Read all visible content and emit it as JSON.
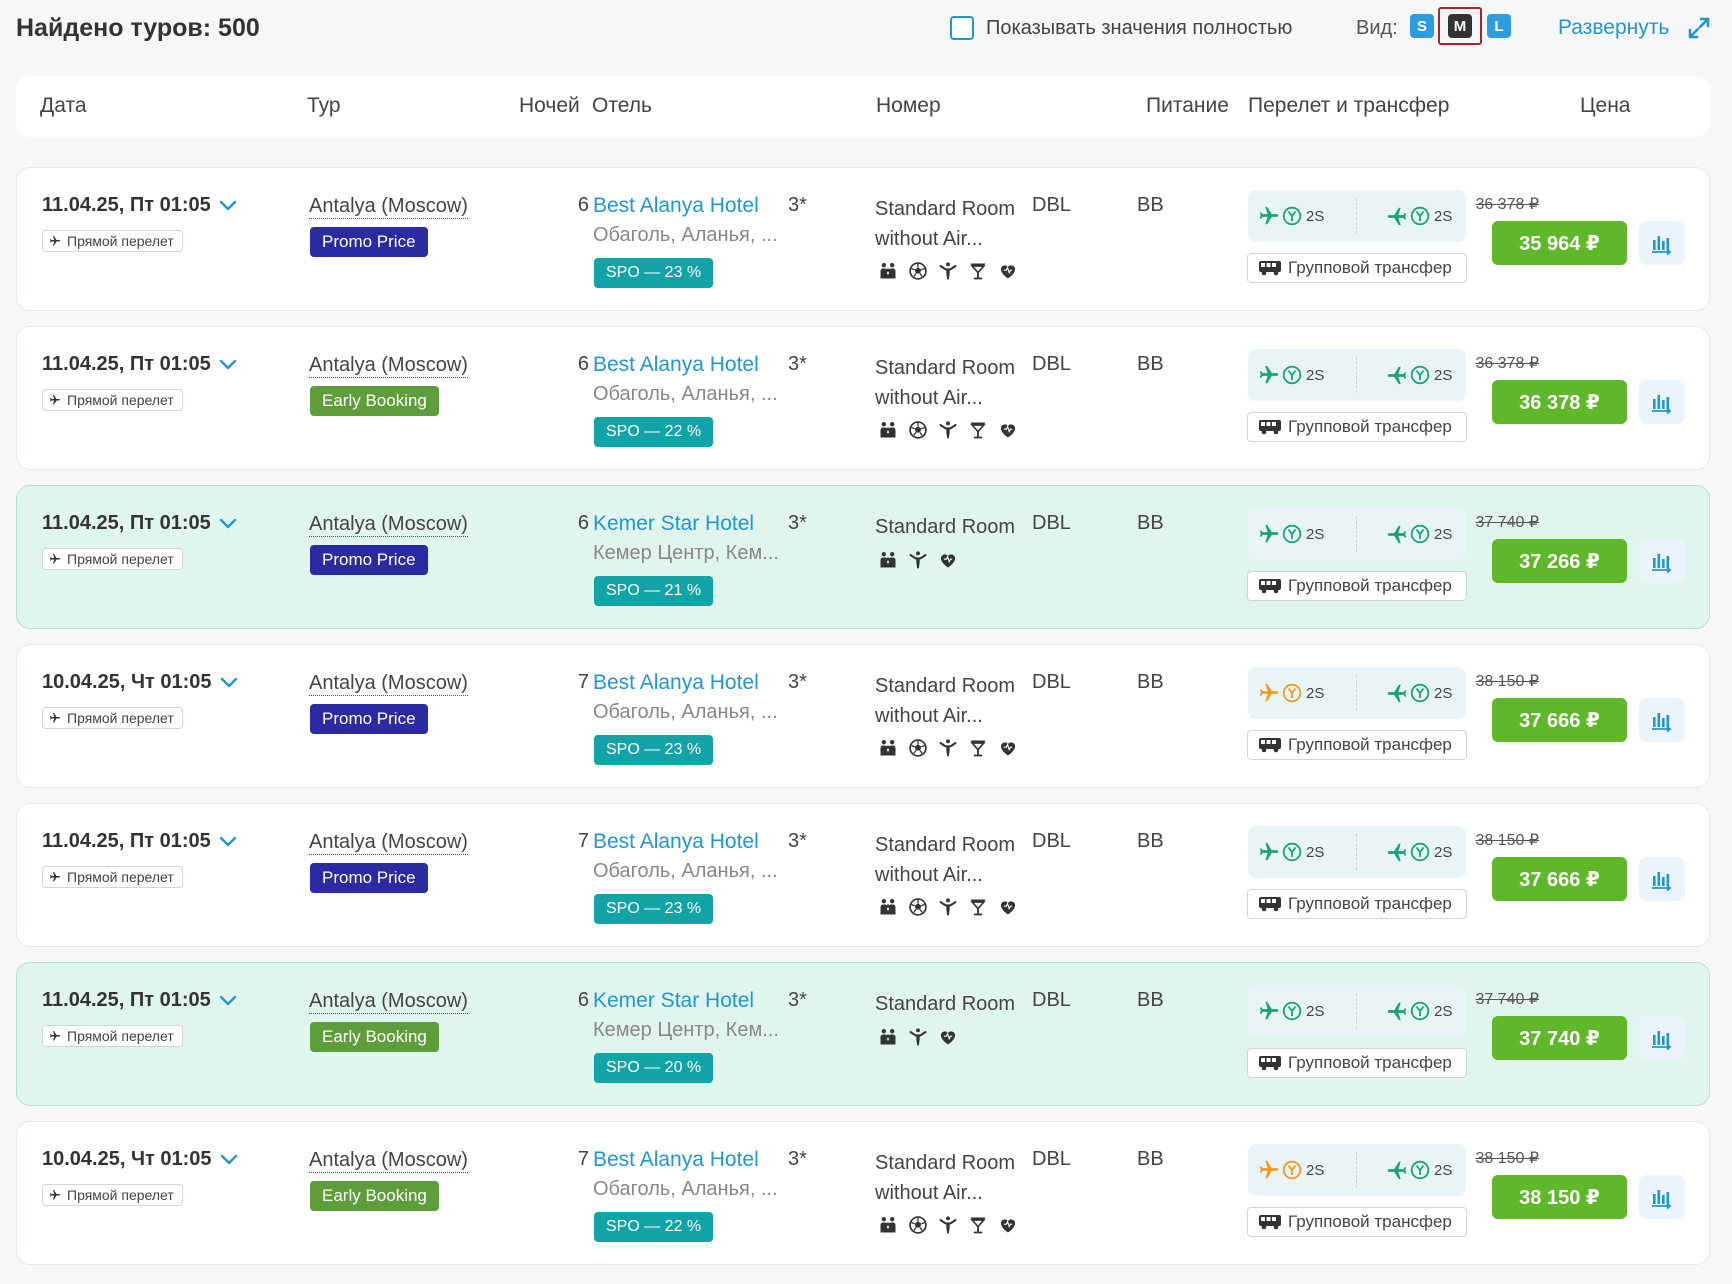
{
  "header": {
    "found_label": "Найдено туров: 500",
    "show_full_label": "Показывать значения полностью",
    "view_label": "Вид:",
    "size_options": [
      "S",
      "M",
      "L"
    ],
    "selected_size": "M",
    "expand_label": "Развернуть"
  },
  "columns": {
    "date": "Дата",
    "tour": "Тур",
    "nights": "Ночей",
    "hotel": "Отель",
    "room": "Номер",
    "meal": "Питание",
    "flight": "Перелет и трансфер",
    "price": "Цена"
  },
  "colors": {
    "accent": "#2196d3",
    "price_green": "#5eb82a",
    "promo_purple": "#2b2aa1",
    "early_green": "#5e9e3a",
    "spo_teal": "#11a3a6",
    "flight_ok": "#1aa37a",
    "flight_warn": "#f39a1e",
    "highlight_row": "#e1f5ef"
  },
  "rows": [
    {
      "date": "11.04.25, Пт  01:05",
      "direct": "Прямой перелет",
      "tour": "Antalya (Moscow)",
      "promo": "Promo Price",
      "promo_type": "purple",
      "nights": "6",
      "hotel": "Best Alanya Hotel",
      "stars": "3*",
      "location": "Обаголь, Аланья, ...",
      "spo": "SPO — 23 %",
      "room_line1": "Standard Room",
      "room_line2": "without Air...",
      "room_type": "DBL",
      "meal": "BB",
      "amenities": [
        "family-icon",
        "football-icon",
        "fitness-icon",
        "bar-icon",
        "heart-icon"
      ],
      "out_class": "2S",
      "out_status": "ok",
      "back_class": "2S",
      "back_status": "ok",
      "transfer": "Групповой трансфер",
      "old_price": "36 378 ₽",
      "price": "35 964 ₽",
      "highlight": false
    },
    {
      "date": "11.04.25, Пт  01:05",
      "direct": "Прямой перелет",
      "tour": "Antalya (Moscow)",
      "promo": "Early Booking",
      "promo_type": "green",
      "nights": "6",
      "hotel": "Best Alanya Hotel",
      "stars": "3*",
      "location": "Обаголь, Аланья, ...",
      "spo": "SPO — 22 %",
      "room_line1": "Standard Room",
      "room_line2": "without Air...",
      "room_type": "DBL",
      "meal": "BB",
      "amenities": [
        "family-icon",
        "football-icon",
        "fitness-icon",
        "bar-icon",
        "heart-icon"
      ],
      "out_class": "2S",
      "out_status": "ok",
      "back_class": "2S",
      "back_status": "ok",
      "transfer": "Групповой трансфер",
      "old_price": "36 378 ₽",
      "price": "36 378 ₽",
      "highlight": false
    },
    {
      "date": "11.04.25, Пт  01:05",
      "direct": "Прямой перелет",
      "tour": "Antalya (Moscow)",
      "promo": "Promo Price",
      "promo_type": "purple",
      "nights": "6",
      "hotel": "Kemer Star Hotel",
      "stars": "3*",
      "location": "Кемер Центр, Кем...",
      "spo": "SPO — 21 %",
      "room_line1": "Standard Room",
      "room_line2": "",
      "room_type": "DBL",
      "meal": "BB",
      "amenities": [
        "family-icon",
        "fitness-icon",
        "heart-icon"
      ],
      "out_class": "2S",
      "out_status": "ok",
      "back_class": "2S",
      "back_status": "ok",
      "transfer": "Групповой трансфер",
      "old_price": "37 740 ₽",
      "price": "37 266 ₽",
      "highlight": true
    },
    {
      "date": "10.04.25, Чт  01:05",
      "direct": "Прямой перелет",
      "tour": "Antalya (Moscow)",
      "promo": "Promo Price",
      "promo_type": "purple",
      "nights": "7",
      "hotel": "Best Alanya Hotel",
      "stars": "3*",
      "location": "Обаголь, Аланья, ...",
      "spo": "SPO — 23 %",
      "room_line1": "Standard Room",
      "room_line2": "without Air...",
      "room_type": "DBL",
      "meal": "BB",
      "amenities": [
        "family-icon",
        "football-icon",
        "fitness-icon",
        "bar-icon",
        "heart-icon"
      ],
      "out_class": "2S",
      "out_status": "warn",
      "back_class": "2S",
      "back_status": "ok",
      "transfer": "Групповой трансфер",
      "old_price": "38 150 ₽",
      "price": "37 666 ₽",
      "highlight": false
    },
    {
      "date": "11.04.25, Пт  01:05",
      "direct": "Прямой перелет",
      "tour": "Antalya (Moscow)",
      "promo": "Promo Price",
      "promo_type": "purple",
      "nights": "7",
      "hotel": "Best Alanya Hotel",
      "stars": "3*",
      "location": "Обаголь, Аланья, ...",
      "spo": "SPO — 23 %",
      "room_line1": "Standard Room",
      "room_line2": "without Air...",
      "room_type": "DBL",
      "meal": "BB",
      "amenities": [
        "family-icon",
        "football-icon",
        "fitness-icon",
        "bar-icon",
        "heart-icon"
      ],
      "out_class": "2S",
      "out_status": "ok",
      "back_class": "2S",
      "back_status": "ok",
      "transfer": "Групповой трансфер",
      "old_price": "38 150 ₽",
      "price": "37 666 ₽",
      "highlight": false
    },
    {
      "date": "11.04.25, Пт  01:05",
      "direct": "Прямой перелет",
      "tour": "Antalya (Moscow)",
      "promo": "Early Booking",
      "promo_type": "green",
      "nights": "6",
      "hotel": "Kemer Star Hotel",
      "stars": "3*",
      "location": "Кемер Центр, Кем...",
      "spo": "SPO — 20 %",
      "room_line1": "Standard Room",
      "room_line2": "",
      "room_type": "DBL",
      "meal": "BB",
      "amenities": [
        "family-icon",
        "fitness-icon",
        "heart-icon"
      ],
      "out_class": "2S",
      "out_status": "ok",
      "back_class": "2S",
      "back_status": "ok",
      "transfer": "Групповой трансфер",
      "old_price": "37 740 ₽",
      "price": "37 740 ₽",
      "highlight": true
    },
    {
      "date": "10.04.25, Чт  01:05",
      "direct": "Прямой перелет",
      "tour": "Antalya (Moscow)",
      "promo": "Early Booking",
      "promo_type": "green",
      "nights": "7",
      "hotel": "Best Alanya Hotel",
      "stars": "3*",
      "location": "Обаголь, Аланья, ...",
      "spo": "SPO — 22 %",
      "room_line1": "Standard Room",
      "room_line2": "without Air...",
      "room_type": "DBL",
      "meal": "BB",
      "amenities": [
        "family-icon",
        "football-icon",
        "fitness-icon",
        "bar-icon",
        "heart-icon"
      ],
      "out_class": "2S",
      "out_status": "warn",
      "back_class": "2S",
      "back_status": "ok",
      "transfer": "Групповой трансфер",
      "old_price": "38 150 ₽",
      "price": "38 150 ₽",
      "highlight": false
    }
  ]
}
